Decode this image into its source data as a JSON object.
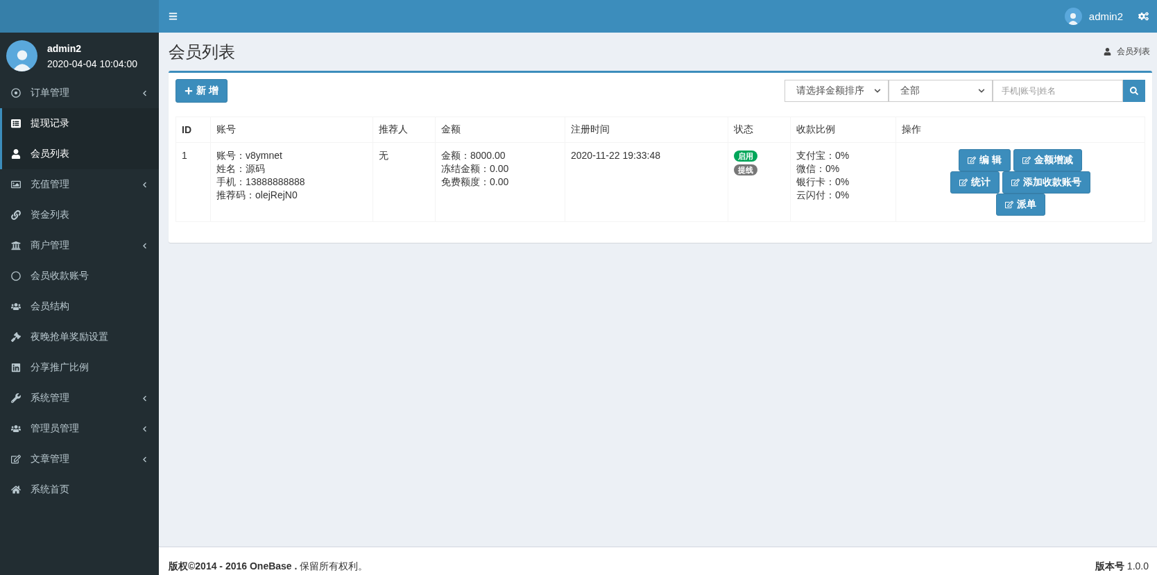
{
  "top_bar": {
    "username": "admin2"
  },
  "user_panel": {
    "name": "admin2",
    "login_time": "2020-04-04 10:04:00"
  },
  "sidebar": {
    "items": [
      {
        "label": "订单管理",
        "expandable": true,
        "selected": false
      },
      {
        "label": "提现记录",
        "expandable": false,
        "selected": true
      },
      {
        "label": "会员列表",
        "expandable": false,
        "selected": true
      },
      {
        "label": "充值管理",
        "expandable": true,
        "selected": false
      },
      {
        "label": "资金列表",
        "expandable": false,
        "selected": false
      },
      {
        "label": "商户管理",
        "expandable": true,
        "selected": false
      },
      {
        "label": "会员收款账号",
        "expandable": false,
        "selected": false
      },
      {
        "label": "会员结构",
        "expandable": false,
        "selected": false
      },
      {
        "label": "夜晚抢单奖励设置",
        "expandable": false,
        "selected": false
      },
      {
        "label": "分享推广比例",
        "expandable": false,
        "selected": false
      },
      {
        "label": "系统管理",
        "expandable": true,
        "selected": false
      },
      {
        "label": "管理员管理",
        "expandable": true,
        "selected": false
      },
      {
        "label": "文章管理",
        "expandable": true,
        "selected": false
      },
      {
        "label": "系统首页",
        "expandable": false,
        "selected": false
      }
    ]
  },
  "page": {
    "title": "会员列表",
    "breadcrumb": "会员列表"
  },
  "toolbar": {
    "add_button": "新 增",
    "sort_select": "请选择金额排序",
    "status_select": "全部",
    "search": {
      "placeholder": "手机|账号|姓名"
    }
  },
  "table": {
    "columns": [
      "ID",
      "账号",
      "推荐人",
      "金额",
      "注册时间",
      "状态",
      "收款比例",
      "操作"
    ],
    "rows": [
      {
        "id": "1",
        "account": [
          "账号：v8ymnet",
          "姓名：源码",
          "手机：13888888888",
          "推荐码：olejRejN0"
        ],
        "referrer": "无",
        "amounts": [
          "金额：8000.00",
          "冻结金额：0.00",
          "免费额度：0.00"
        ],
        "registered": "2020-11-22 19:33:48",
        "status": [
          {
            "label": "启用",
            "color": "#00a65a"
          },
          {
            "label": "提线",
            "color": "#777777"
          }
        ],
        "ratios": [
          "支付宝：0%",
          "微信：0%",
          "银行卡：0%",
          "云闪付：0%"
        ],
        "actions": [
          [
            "编 辑",
            "金额增减"
          ],
          [
            "统计",
            "添加收款账号"
          ],
          [
            "派单"
          ]
        ]
      }
    ]
  },
  "footer": {
    "copyright": "**版权©2014 - 2016 OneBase .** 保留所有权利。",
    "version_label": "版本号",
    "version": "1.0.0"
  }
}
